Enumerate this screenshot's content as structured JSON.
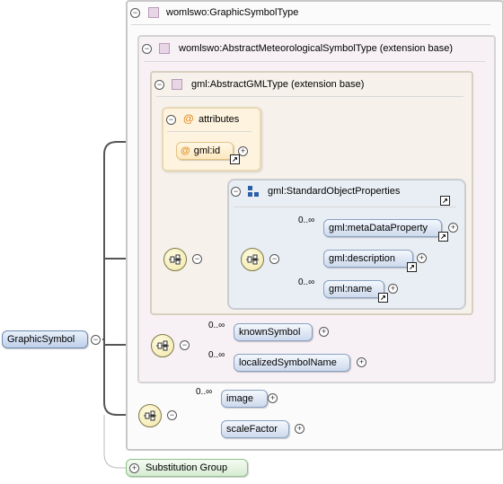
{
  "root": {
    "label": "GraphicSymbol"
  },
  "type": {
    "label": "womlswo:GraphicSymbolType"
  },
  "ext1": {
    "label": "womlswo:AbstractMeteorologicalSymbolType (extension base)"
  },
  "ext2": {
    "label": "gml:AbstractGMLType (extension base)"
  },
  "attributes": {
    "title": "attributes",
    "id_label": "gml:id"
  },
  "std_props": {
    "label": "gml:StandardObjectProperties"
  },
  "elements": {
    "metaDataProperty": "gml:metaDataProperty",
    "description": "gml:description",
    "name": "gml:name",
    "knownSymbol": "knownSymbol",
    "localizedSymbolName": "localizedSymbolName",
    "image": "image",
    "scaleFactor": "scaleFactor"
  },
  "occurrences": {
    "metaDataProperty": "0..∞",
    "name": "0..∞",
    "knownSymbol": "0..∞",
    "localizedSymbolName": "0..∞",
    "image": "0..∞"
  },
  "substitution": {
    "label": "Substitution Group"
  },
  "icons": {
    "collapse": "minus-icon",
    "expand": "plus-icon",
    "type": "type-square-icon",
    "attribute": "at-sign-icon",
    "reference": "reference-arrow-icon",
    "sequence": "sequence-compositor-icon",
    "group": "group-icon"
  },
  "colors": {
    "root_pill": "#bfd0ea",
    "element_pill": "#cdd9ec",
    "attribute_box": "#fdf3df",
    "substitution_pill": "#d6ecd2",
    "compositor": "#f1e7a8"
  }
}
